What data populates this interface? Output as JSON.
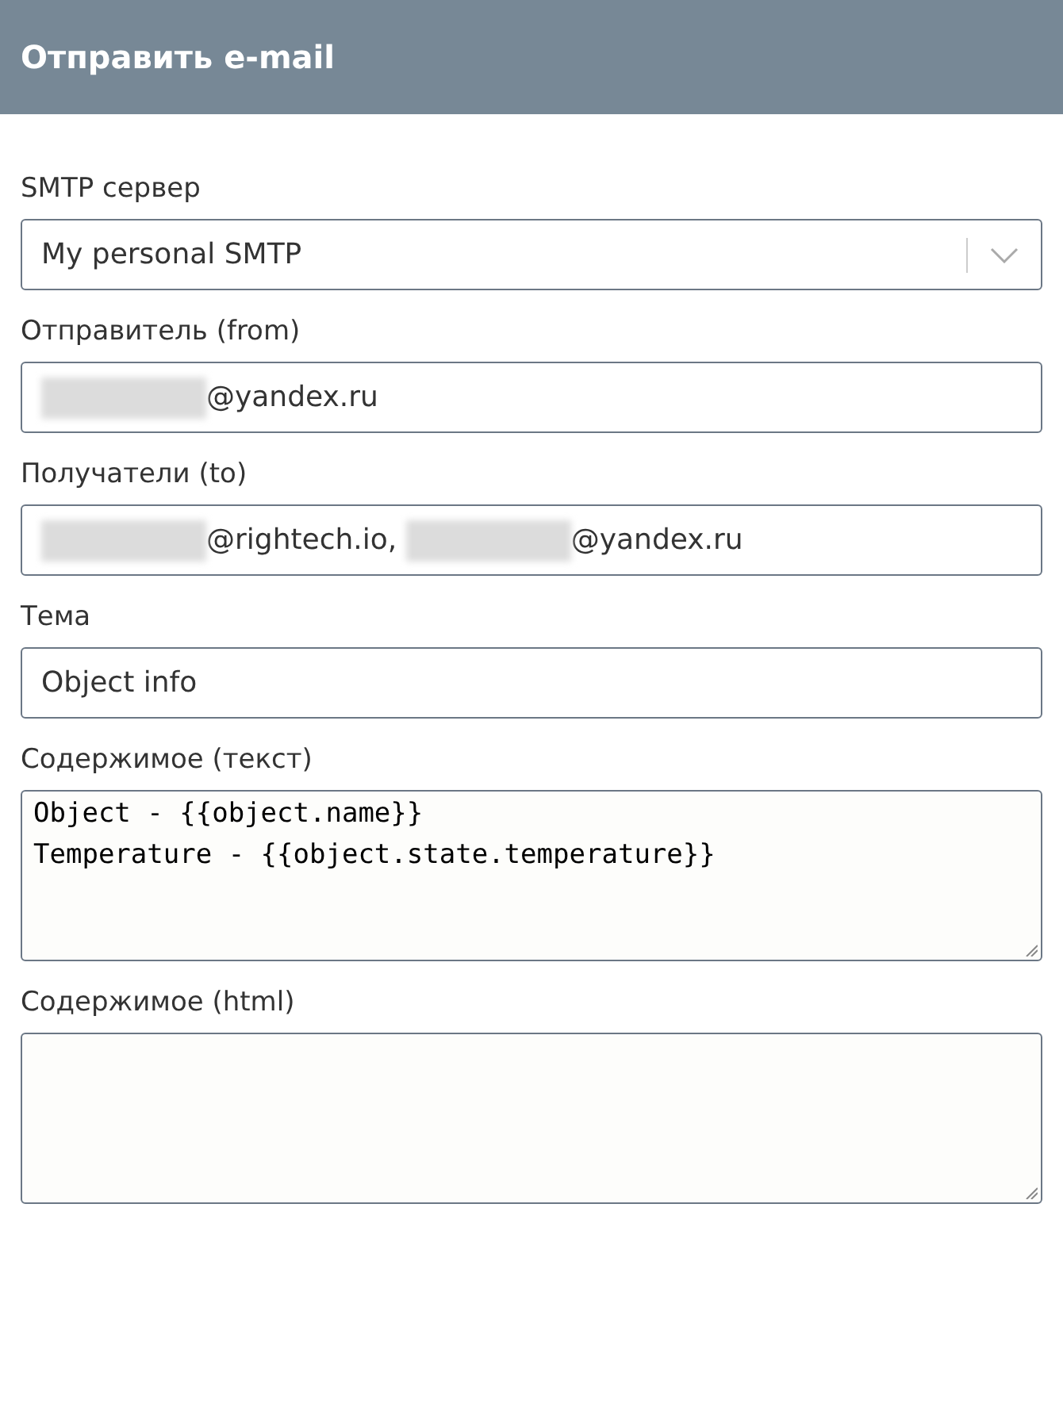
{
  "header": {
    "title": "Отправить e-mail"
  },
  "fields": [
    {
      "kind": "select",
      "label": "SMTP сервер",
      "value": [
        {
          "kind": "text",
          "text": "My personal SMTP"
        }
      ]
    },
    {
      "kind": "input",
      "label": "Отправитель (from)",
      "value": [
        {
          "kind": "blur"
        },
        {
          "kind": "text",
          "text": "@yandex.ru"
        }
      ]
    },
    {
      "kind": "input",
      "label": "Получатели (to)",
      "value": [
        {
          "kind": "blur"
        },
        {
          "kind": "text",
          "text": "@rightech.io, "
        },
        {
          "kind": "blur"
        },
        {
          "kind": "text",
          "text": "@yandex.ru"
        }
      ]
    },
    {
      "kind": "input",
      "label": "Тема",
      "value": [
        {
          "kind": "text",
          "text": "Object info"
        }
      ]
    },
    {
      "kind": "textarea",
      "label": "Содержимое (текст)",
      "lines": [
        "Object - {{object.name}}",
        "Temperature - {{object.state.temperature}}"
      ]
    },
    {
      "kind": "textarea",
      "label": "Содержимое (html)"
    }
  ]
}
